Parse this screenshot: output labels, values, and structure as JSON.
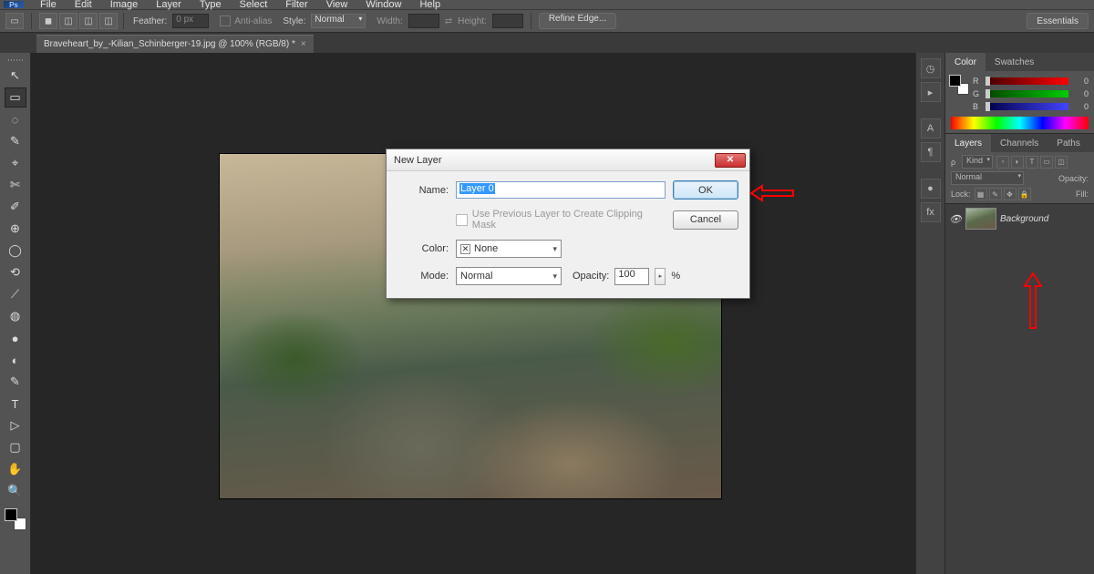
{
  "app": {
    "name": "Ps"
  },
  "menu": {
    "items": [
      "File",
      "Edit",
      "Image",
      "Layer",
      "Type",
      "Select",
      "Filter",
      "View",
      "Window",
      "Help"
    ]
  },
  "options": {
    "feather_label": "Feather:",
    "feather_value": "0 px",
    "anti_alias": "Anti-alias",
    "style_label": "Style:",
    "style_value": "Normal",
    "width_label": "Width:",
    "height_label": "Height:",
    "refine_edge": "Refine Edge..."
  },
  "workspace_button": "Essentials",
  "document": {
    "tab_title": "Braveheart_by_-Kilian_Schinberger-19.jpg @ 100% (RGB/8) *"
  },
  "dialog": {
    "title": "New Layer",
    "name_label": "Name:",
    "name_value": "Layer 0",
    "clip_checkbox": "Use Previous Layer to Create Clipping Mask",
    "color_label": "Color:",
    "color_value": "None",
    "mode_label": "Mode:",
    "mode_value": "Normal",
    "opacity_label": "Opacity:",
    "opacity_value": "100",
    "opacity_suffix": "%",
    "ok": "OK",
    "cancel": "Cancel"
  },
  "color_panel": {
    "tab_color": "Color",
    "tab_swatches": "Swatches",
    "r_label": "R",
    "g_label": "G",
    "b_label": "B",
    "r_val": "0",
    "g_val": "0",
    "b_val": "0"
  },
  "layers_panel": {
    "tab_layers": "Layers",
    "tab_channels": "Channels",
    "tab_paths": "Paths",
    "kind_label": "Kind",
    "blend_mode": "Normal",
    "opacity_label": "Opacity:",
    "lock_label": "Lock:",
    "fill_label": "Fill:",
    "layer_name": "Background"
  },
  "tools": [
    "↖",
    "▭",
    "◌",
    "✎",
    "⌖",
    "✄",
    "✐",
    "⊕",
    "◯",
    "⟲",
    "⟋",
    "◍",
    "●",
    "◐",
    "✎",
    "T",
    "▷",
    "▢",
    "✋",
    "🔍"
  ]
}
